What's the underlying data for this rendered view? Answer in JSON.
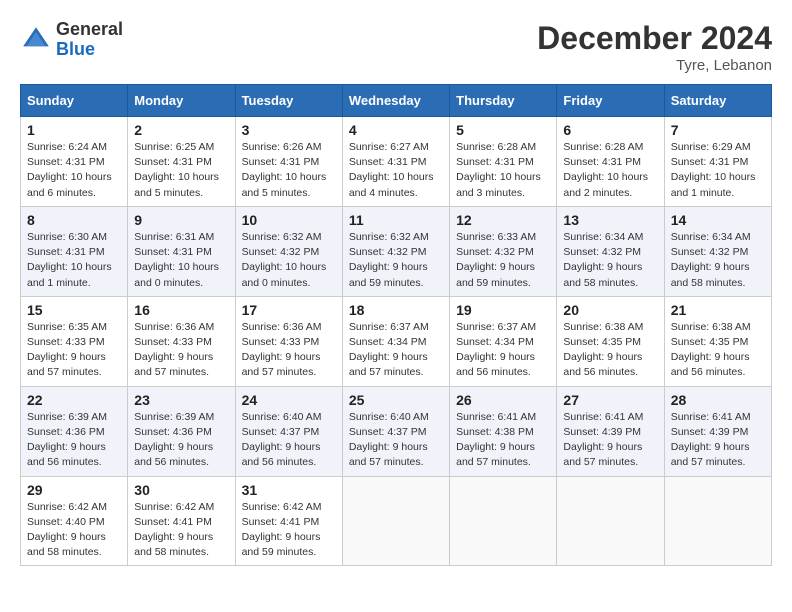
{
  "header": {
    "logo_general": "General",
    "logo_blue": "Blue",
    "month_title": "December 2024",
    "location": "Tyre, Lebanon"
  },
  "columns": [
    "Sunday",
    "Monday",
    "Tuesday",
    "Wednesday",
    "Thursday",
    "Friday",
    "Saturday"
  ],
  "weeks": [
    [
      {
        "day": "1",
        "sunrise": "Sunrise: 6:24 AM",
        "sunset": "Sunset: 4:31 PM",
        "daylight": "Daylight: 10 hours and 6 minutes."
      },
      {
        "day": "2",
        "sunrise": "Sunrise: 6:25 AM",
        "sunset": "Sunset: 4:31 PM",
        "daylight": "Daylight: 10 hours and 5 minutes."
      },
      {
        "day": "3",
        "sunrise": "Sunrise: 6:26 AM",
        "sunset": "Sunset: 4:31 PM",
        "daylight": "Daylight: 10 hours and 5 minutes."
      },
      {
        "day": "4",
        "sunrise": "Sunrise: 6:27 AM",
        "sunset": "Sunset: 4:31 PM",
        "daylight": "Daylight: 10 hours and 4 minutes."
      },
      {
        "day": "5",
        "sunrise": "Sunrise: 6:28 AM",
        "sunset": "Sunset: 4:31 PM",
        "daylight": "Daylight: 10 hours and 3 minutes."
      },
      {
        "day": "6",
        "sunrise": "Sunrise: 6:28 AM",
        "sunset": "Sunset: 4:31 PM",
        "daylight": "Daylight: 10 hours and 2 minutes."
      },
      {
        "day": "7",
        "sunrise": "Sunrise: 6:29 AM",
        "sunset": "Sunset: 4:31 PM",
        "daylight": "Daylight: 10 hours and 1 minute."
      }
    ],
    [
      {
        "day": "8",
        "sunrise": "Sunrise: 6:30 AM",
        "sunset": "Sunset: 4:31 PM",
        "daylight": "Daylight: 10 hours and 1 minute."
      },
      {
        "day": "9",
        "sunrise": "Sunrise: 6:31 AM",
        "sunset": "Sunset: 4:31 PM",
        "daylight": "Daylight: 10 hours and 0 minutes."
      },
      {
        "day": "10",
        "sunrise": "Sunrise: 6:32 AM",
        "sunset": "Sunset: 4:32 PM",
        "daylight": "Daylight: 10 hours and 0 minutes."
      },
      {
        "day": "11",
        "sunrise": "Sunrise: 6:32 AM",
        "sunset": "Sunset: 4:32 PM",
        "daylight": "Daylight: 9 hours and 59 minutes."
      },
      {
        "day": "12",
        "sunrise": "Sunrise: 6:33 AM",
        "sunset": "Sunset: 4:32 PM",
        "daylight": "Daylight: 9 hours and 59 minutes."
      },
      {
        "day": "13",
        "sunrise": "Sunrise: 6:34 AM",
        "sunset": "Sunset: 4:32 PM",
        "daylight": "Daylight: 9 hours and 58 minutes."
      },
      {
        "day": "14",
        "sunrise": "Sunrise: 6:34 AM",
        "sunset": "Sunset: 4:32 PM",
        "daylight": "Daylight: 9 hours and 58 minutes."
      }
    ],
    [
      {
        "day": "15",
        "sunrise": "Sunrise: 6:35 AM",
        "sunset": "Sunset: 4:33 PM",
        "daylight": "Daylight: 9 hours and 57 minutes."
      },
      {
        "day": "16",
        "sunrise": "Sunrise: 6:36 AM",
        "sunset": "Sunset: 4:33 PM",
        "daylight": "Daylight: 9 hours and 57 minutes."
      },
      {
        "day": "17",
        "sunrise": "Sunrise: 6:36 AM",
        "sunset": "Sunset: 4:33 PM",
        "daylight": "Daylight: 9 hours and 57 minutes."
      },
      {
        "day": "18",
        "sunrise": "Sunrise: 6:37 AM",
        "sunset": "Sunset: 4:34 PM",
        "daylight": "Daylight: 9 hours and 57 minutes."
      },
      {
        "day": "19",
        "sunrise": "Sunrise: 6:37 AM",
        "sunset": "Sunset: 4:34 PM",
        "daylight": "Daylight: 9 hours and 56 minutes."
      },
      {
        "day": "20",
        "sunrise": "Sunrise: 6:38 AM",
        "sunset": "Sunset: 4:35 PM",
        "daylight": "Daylight: 9 hours and 56 minutes."
      },
      {
        "day": "21",
        "sunrise": "Sunrise: 6:38 AM",
        "sunset": "Sunset: 4:35 PM",
        "daylight": "Daylight: 9 hours and 56 minutes."
      }
    ],
    [
      {
        "day": "22",
        "sunrise": "Sunrise: 6:39 AM",
        "sunset": "Sunset: 4:36 PM",
        "daylight": "Daylight: 9 hours and 56 minutes."
      },
      {
        "day": "23",
        "sunrise": "Sunrise: 6:39 AM",
        "sunset": "Sunset: 4:36 PM",
        "daylight": "Daylight: 9 hours and 56 minutes."
      },
      {
        "day": "24",
        "sunrise": "Sunrise: 6:40 AM",
        "sunset": "Sunset: 4:37 PM",
        "daylight": "Daylight: 9 hours and 56 minutes."
      },
      {
        "day": "25",
        "sunrise": "Sunrise: 6:40 AM",
        "sunset": "Sunset: 4:37 PM",
        "daylight": "Daylight: 9 hours and 57 minutes."
      },
      {
        "day": "26",
        "sunrise": "Sunrise: 6:41 AM",
        "sunset": "Sunset: 4:38 PM",
        "daylight": "Daylight: 9 hours and 57 minutes."
      },
      {
        "day": "27",
        "sunrise": "Sunrise: 6:41 AM",
        "sunset": "Sunset: 4:39 PM",
        "daylight": "Daylight: 9 hours and 57 minutes."
      },
      {
        "day": "28",
        "sunrise": "Sunrise: 6:41 AM",
        "sunset": "Sunset: 4:39 PM",
        "daylight": "Daylight: 9 hours and 57 minutes."
      }
    ],
    [
      {
        "day": "29",
        "sunrise": "Sunrise: 6:42 AM",
        "sunset": "Sunset: 4:40 PM",
        "daylight": "Daylight: 9 hours and 58 minutes."
      },
      {
        "day": "30",
        "sunrise": "Sunrise: 6:42 AM",
        "sunset": "Sunset: 4:41 PM",
        "daylight": "Daylight: 9 hours and 58 minutes."
      },
      {
        "day": "31",
        "sunrise": "Sunrise: 6:42 AM",
        "sunset": "Sunset: 4:41 PM",
        "daylight": "Daylight: 9 hours and 59 minutes."
      },
      null,
      null,
      null,
      null
    ]
  ]
}
